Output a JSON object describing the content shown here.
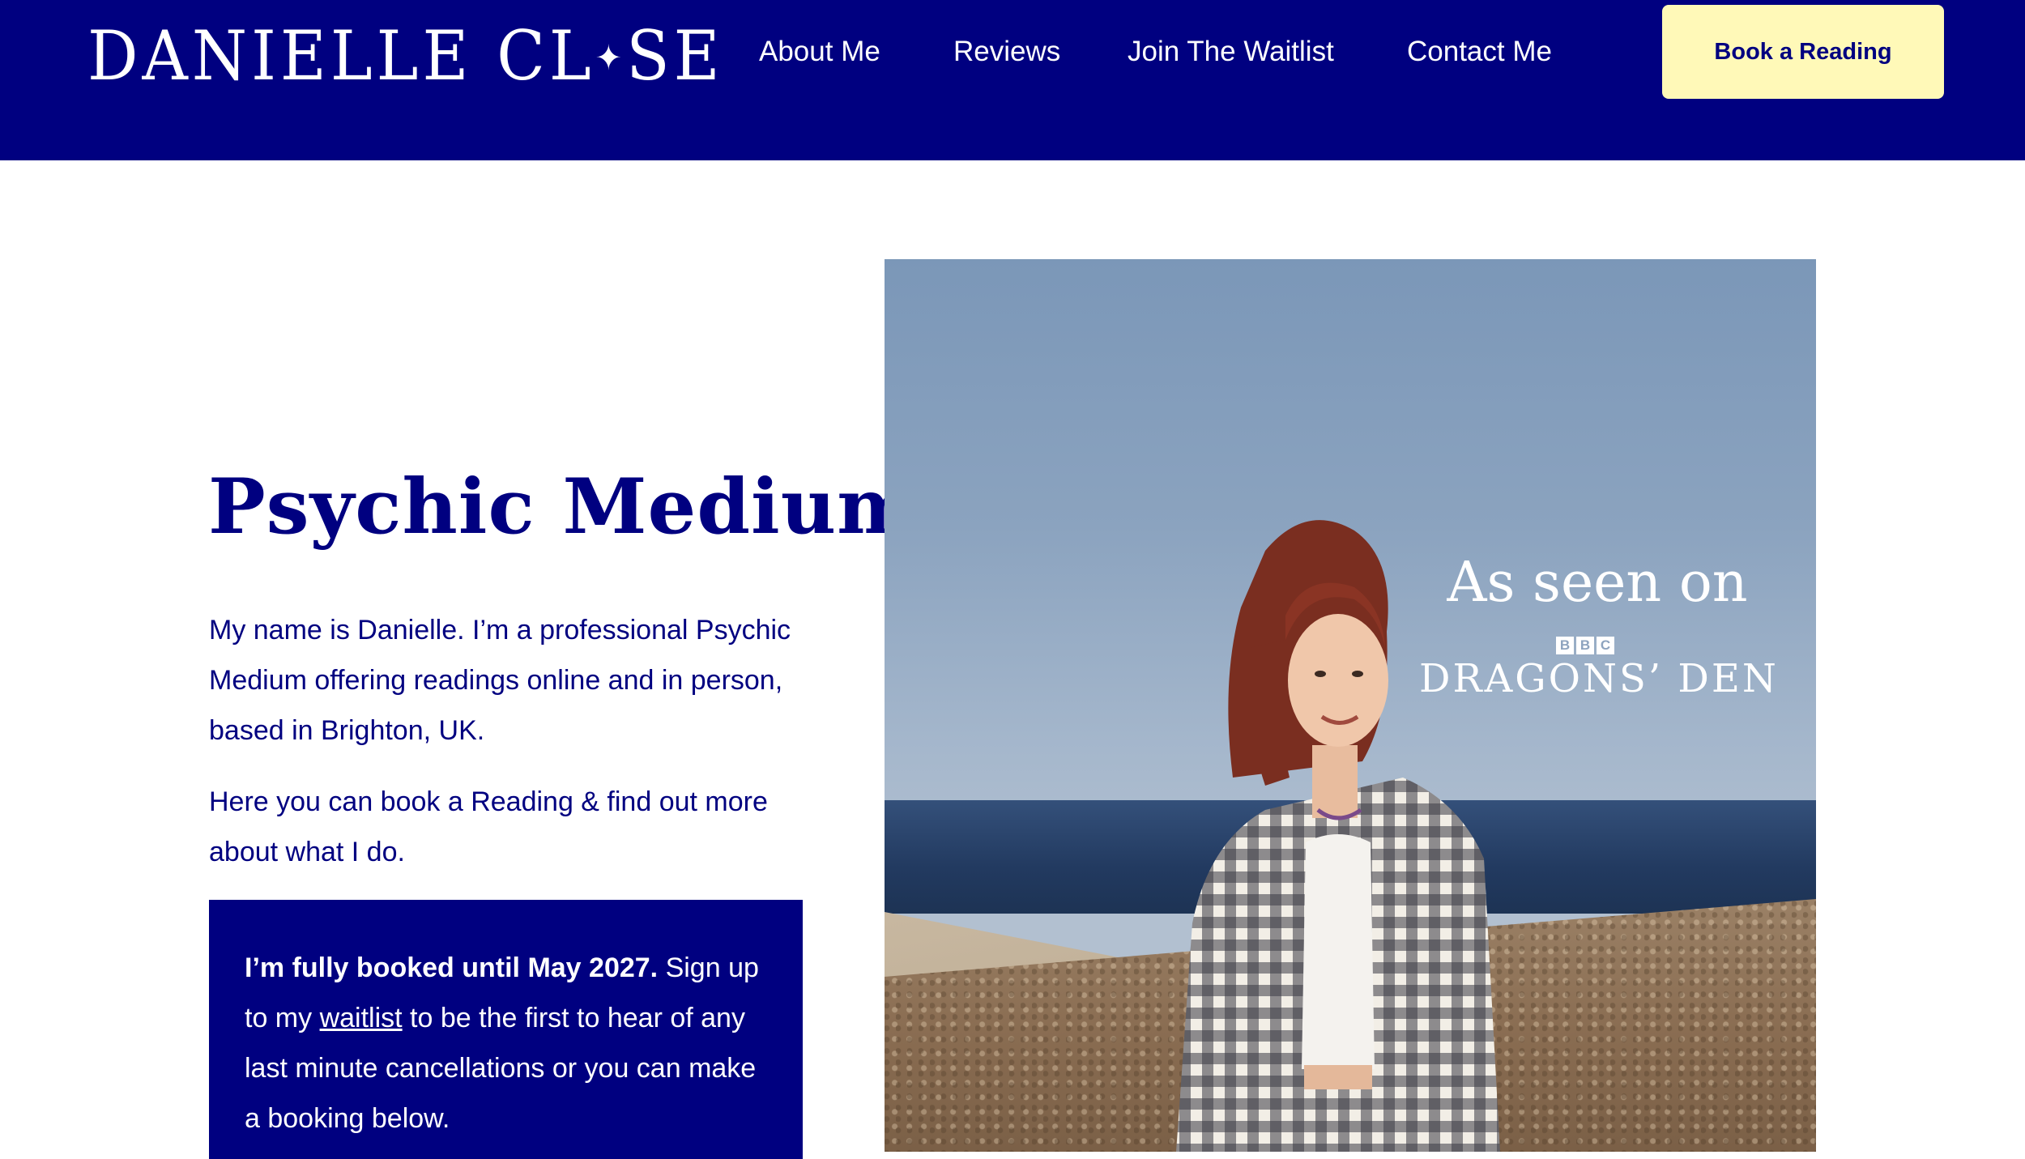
{
  "header": {
    "logo_text": "DANIELLE CLOSE",
    "logo_before_star": "DANIELLE CL",
    "logo_star": "✦",
    "logo_after_star": "SE",
    "nav": [
      {
        "label": "About Me"
      },
      {
        "label": "Reviews"
      },
      {
        "label": "Join The Waitlist"
      },
      {
        "label": "Contact Me"
      }
    ],
    "cta_label": "Book a Reading"
  },
  "hero": {
    "title": "Psychic Medium",
    "intro_1": "My name is Danielle. I’m a professional Psychic Medium offering readings online and in person, based in Brighton, UK.",
    "intro_2": "Here you can book a Reading & find out more about what I do.",
    "booking": {
      "bold": "I’m fully booked until May 2027.",
      "before_link": " Sign up to my ",
      "link": "waitlist",
      "after_link": " to be the first to hear of any last minute cancellations or you can make a booking below."
    }
  },
  "image": {
    "as_seen_on": "As seen on",
    "network_letters": [
      "B",
      "B",
      "C"
    ],
    "show": "DRAGONS’ DEN"
  },
  "colors": {
    "brand_navy": "#000080",
    "cta_yellow": "#fff9b8",
    "white": "#ffffff"
  }
}
